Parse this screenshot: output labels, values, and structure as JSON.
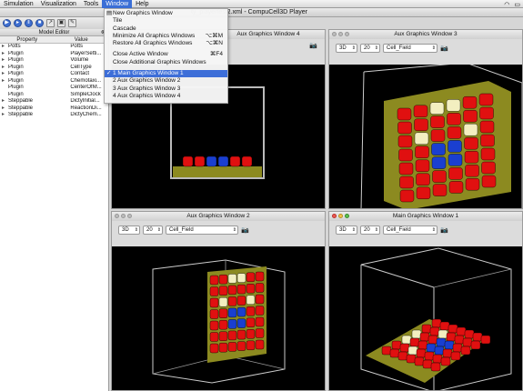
{
  "menubar": {
    "items": [
      "Simulation",
      "Visualization",
      "Tools",
      "Window",
      "Help"
    ],
    "active": "Window"
  },
  "titlebar": {
    "title": "ty_playertest2.xml - CompuCell3D Player"
  },
  "model_editor": {
    "title": "Model Editor",
    "col_property": "Property",
    "col_value": "Value",
    "rows": [
      {
        "p": "Potts",
        "v": "Potts"
      },
      {
        "p": "Plugin",
        "v": "PlayerSetti..."
      },
      {
        "p": "Plugin",
        "v": "Volume"
      },
      {
        "p": "Plugin",
        "v": "CellType"
      },
      {
        "p": "Plugin",
        "v": "Contact"
      },
      {
        "p": "Plugin",
        "v": "Chemotaxi..."
      },
      {
        "p": "Plugin",
        "v": "CenterOfM..."
      },
      {
        "p": "Plugin",
        "v": "SimpleClock"
      },
      {
        "p": "Steppable",
        "v": "DictyInitial..."
      },
      {
        "p": "Steppable",
        "v": "ReactionDi..."
      },
      {
        "p": "Steppable",
        "v": "DictyChem..."
      }
    ]
  },
  "window_menu": {
    "items": [
      {
        "label": "New Graphics Window",
        "shortcut": ""
      },
      {
        "label": "Tile",
        "shortcut": ""
      },
      {
        "label": "Cascade",
        "shortcut": ""
      },
      {
        "label": "Minimize All Graphics Windows",
        "shortcut": "⌥⌘M"
      },
      {
        "label": "Restore All Graphics Windows",
        "shortcut": "⌥⌘N"
      },
      {
        "label": "Close Active Window",
        "shortcut": "⌘F4"
      },
      {
        "label": "Close Additional Graphics Windows",
        "shortcut": ""
      },
      {
        "label": "1 Main Graphics Window 1",
        "shortcut": ""
      },
      {
        "label": "2 Aux Graphics Window 2",
        "shortcut": ""
      },
      {
        "label": "3 Aux Graphics Window 3",
        "shortcut": ""
      },
      {
        "label": "4 Aux Graphics Window 4",
        "shortcut": ""
      }
    ]
  },
  "windows": {
    "w4": {
      "title": "Aux Graphics Window 4"
    },
    "w3": {
      "title": "Aux Graphics Window 3",
      "dim": "3D",
      "slice": "20",
      "field": "Cell_Field"
    },
    "w2": {
      "title": "Aux Graphics Window 2",
      "dim": "3D",
      "slice": "20",
      "field": "Cell_Field"
    },
    "w1": {
      "title": "Main Graphics Window 1",
      "dim": "3D",
      "slice": "20",
      "field": "Cell_Field"
    }
  },
  "colors": {
    "red": "#e01010",
    "blue": "#1a3fd0",
    "cream": "#f3efc0",
    "olive": "#8c8a20"
  }
}
